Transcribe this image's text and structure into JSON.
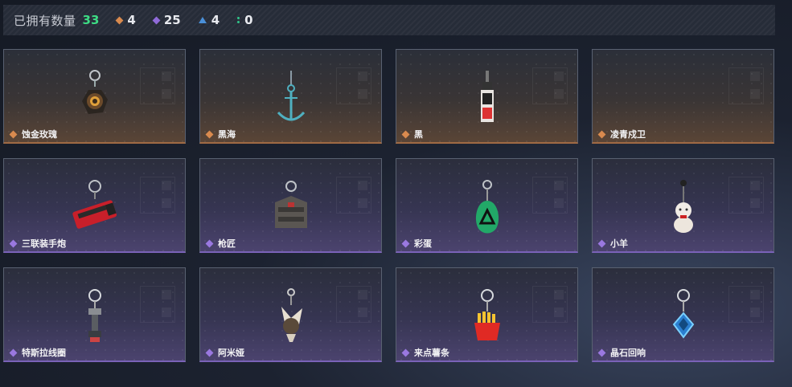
{
  "header": {
    "owned_label": "已拥有数量",
    "owned_count": "33",
    "stats": [
      {
        "icon": "orange-diamond-icon",
        "value": "4",
        "color": "#d98a4e"
      },
      {
        "icon": "purple-diamond-icon",
        "value": "25",
        "color": "#8f6ad8"
      },
      {
        "icon": "blue-triangle-icon",
        "value": "4",
        "color": "#4a90d9"
      },
      {
        "icon": "green-dots-icon",
        "value": "0",
        "color": "#30c58a"
      }
    ]
  },
  "items": [
    {
      "name": "蚀金玫瑰",
      "rarity": "orange",
      "icon": "rose-emblem-charm"
    },
    {
      "name": "黑海",
      "rarity": "orange",
      "icon": "anchor-charm"
    },
    {
      "name": "黑",
      "rarity": "orange",
      "icon": "tag-card-charm"
    },
    {
      "name": "凌青戍卫",
      "rarity": "orange",
      "icon": "empty"
    },
    {
      "name": "三联装手炮",
      "rarity": "purple",
      "icon": "red-cannon-charm"
    },
    {
      "name": "枪匠",
      "rarity": "purple",
      "icon": "gunsmith-box-charm"
    },
    {
      "name": "彩蛋",
      "rarity": "purple",
      "icon": "green-egg-charm"
    },
    {
      "name": "小羊",
      "rarity": "purple",
      "icon": "lamb-figure-charm"
    },
    {
      "name": "特斯拉线圈",
      "rarity": "purple",
      "icon": "tesla-coil-charm"
    },
    {
      "name": "阿米娅",
      "rarity": "purple",
      "icon": "bunny-figure-charm"
    },
    {
      "name": "来点薯条",
      "rarity": "purple",
      "icon": "fries-charm"
    },
    {
      "name": "晶石回响",
      "rarity": "purple",
      "icon": "crystal-charm"
    }
  ]
}
